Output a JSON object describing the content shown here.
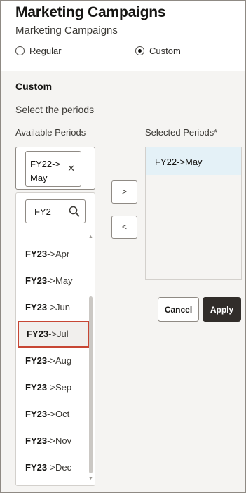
{
  "header": {
    "title": "Marketing Campaigns",
    "subtitle": "Marketing Campaigns"
  },
  "view_mode": {
    "options": [
      {
        "label": "Regular",
        "checked": false
      },
      {
        "label": "Custom",
        "checked": true
      }
    ]
  },
  "custom": {
    "heading": "Custom",
    "instruction": "Select the periods",
    "available_label": "Available Periods",
    "selected_label": "Selected Periods*"
  },
  "filter": {
    "chip_value": "FY22->May",
    "chip_remove_icon": "close-icon",
    "search_value": "FY2",
    "search_icon": "search-icon"
  },
  "available_periods": [
    {
      "match": "FY23",
      "rest": "->Apr"
    },
    {
      "match": "FY23",
      "rest": "->May"
    },
    {
      "match": "FY23",
      "rest": "->Jun"
    },
    {
      "match": "FY23",
      "rest": "->Jul"
    },
    {
      "match": "FY23",
      "rest": "->Aug"
    },
    {
      "match": "FY23",
      "rest": "->Sep"
    },
    {
      "match": "FY23",
      "rest": "->Oct"
    },
    {
      "match": "FY23",
      "rest": "->Nov"
    },
    {
      "match": "FY23",
      "rest": "->Dec"
    }
  ],
  "highlighted_index": 3,
  "move_buttons": {
    "add": ">",
    "remove": "<"
  },
  "selected_periods": [
    "FY22->May"
  ],
  "actions": {
    "cancel": "Cancel",
    "apply": "Apply"
  },
  "colors": {
    "highlight_border": "#c74634",
    "selected_row": "#e4f1f7",
    "primary_button": "#312d2a"
  }
}
